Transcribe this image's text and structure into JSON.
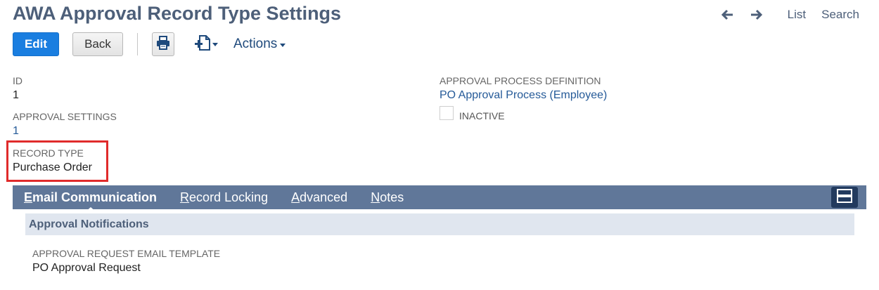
{
  "header": {
    "title": "AWA Approval Record Type Settings",
    "nav": {
      "back_arrow_icon": "arrow-left-icon",
      "forward_arrow_icon": "arrow-right-icon",
      "list_label": "List",
      "search_label": "Search"
    }
  },
  "toolbar": {
    "edit_label": "Edit",
    "back_label": "Back",
    "print_icon": "printer-icon",
    "new_record_icon": "new-document-icon",
    "actions_label": "Actions"
  },
  "fields": {
    "id": {
      "label": "ID",
      "value": "1"
    },
    "approval_settings": {
      "label": "APPROVAL SETTINGS",
      "value": "1"
    },
    "record_type": {
      "label": "RECORD TYPE",
      "value": "Purchase Order"
    },
    "approval_process_definition": {
      "label": "APPROVAL PROCESS DEFINITION",
      "value": "PO Approval Process (Employee)"
    },
    "inactive": {
      "label": "INACTIVE",
      "checked": false
    }
  },
  "tabs": [
    {
      "pre": "",
      "u": "E",
      "post": "mail Communication",
      "active": true
    },
    {
      "pre": "",
      "u": "R",
      "post": "ecord Locking",
      "active": false
    },
    {
      "pre": "",
      "u": "A",
      "post": "dvanced",
      "active": false
    },
    {
      "pre": "",
      "u": "N",
      "post": "otes",
      "active": false
    }
  ],
  "section": {
    "title": "Approval Notifications",
    "fields": {
      "approval_request_email_template": {
        "label": "APPROVAL REQUEST EMAIL TEMPLATE",
        "value": "PO Approval Request"
      }
    }
  },
  "colors": {
    "accent": "#1a7ee0",
    "tabbar": "#607799",
    "title": "#4d5f79",
    "highlight": "#e02b2b",
    "link": "#255a98"
  }
}
